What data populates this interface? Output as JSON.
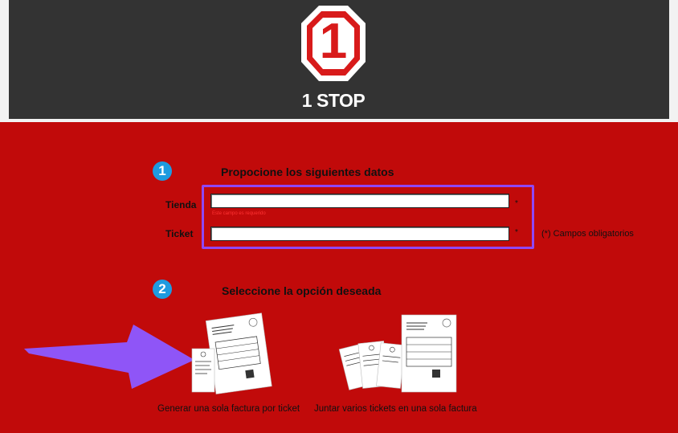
{
  "header": {
    "logo_number": "1",
    "logo_text": "1 STOP"
  },
  "step1": {
    "number": "1",
    "title": "Propocione los siguientes datos",
    "tienda_label": "Tienda",
    "tienda_value": "",
    "tienda_required": "*",
    "tienda_error": "Este campo es requerido",
    "ticket_label": "Ticket",
    "ticket_value": "",
    "ticket_required": "*",
    "required_note": "(*) Campos obligatorios"
  },
  "step2": {
    "number": "2",
    "title": "Seleccione la opción deseada",
    "option_single": "Generar una sola factura por ticket",
    "option_multi": "Juntar varios tickets en una sola factura"
  },
  "colors": {
    "background": "#c10a0a",
    "header": "#333333",
    "step_circle": "#1e9be0",
    "highlight": "#8f47f5"
  }
}
